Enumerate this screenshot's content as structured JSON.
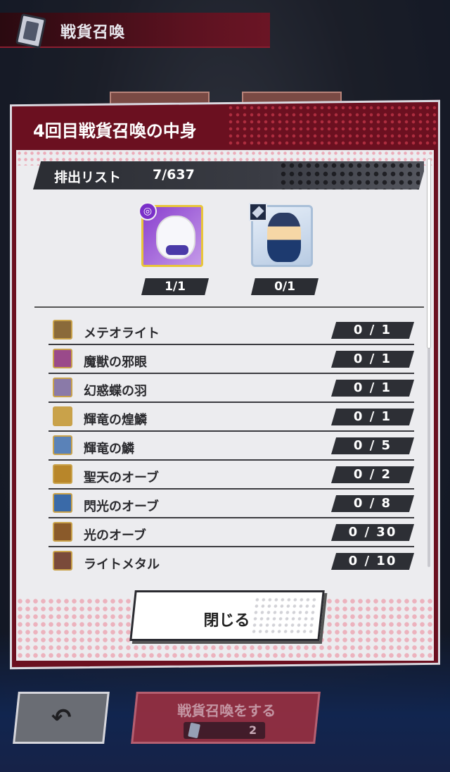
{
  "header": {
    "title": "戦貨召喚"
  },
  "dialog": {
    "title": "4回目戦貨召喚の中身",
    "list_label": "排出リスト",
    "list_count": "7/637",
    "featured": [
      {
        "count": "1/1",
        "badge": "purple-orb-badge"
      },
      {
        "count": "0/1",
        "badge": "card-badge"
      }
    ],
    "items": [
      {
        "name": "メテオライト",
        "count": "0 / 1",
        "icon": "meteorite-icon",
        "color": "#8a6a3a"
      },
      {
        "name": "魔獣の邪眼",
        "count": "0 / 1",
        "icon": "evil-eye-icon",
        "color": "#9a4a8a"
      },
      {
        "name": "幻惑蝶の羽",
        "count": "0 / 1",
        "icon": "butterfly-wing-icon",
        "color": "#8a7aa8"
      },
      {
        "name": "輝竜の煌鱗",
        "count": "0 / 1",
        "icon": "dragon-gem-scale-icon",
        "color": "#c9a24a"
      },
      {
        "name": "輝竜の鱗",
        "count": "0 / 5",
        "icon": "dragon-scale-icon",
        "color": "#5a82b8"
      },
      {
        "name": "聖天のオーブ",
        "count": "0 / 2",
        "icon": "holy-orb-icon",
        "color": "#b8862a"
      },
      {
        "name": "閃光のオーブ",
        "count": "0 / 8",
        "icon": "flash-orb-icon",
        "color": "#3a6aa8"
      },
      {
        "name": "光のオーブ",
        "count": "0 / 30",
        "icon": "light-orb-icon",
        "color": "#8a5a2a"
      },
      {
        "name": "ライトメタル",
        "count": "0 / 10",
        "icon": "light-metal-icon",
        "color": "#7a4a3a"
      }
    ],
    "close_label": "閉じる"
  },
  "footer": {
    "summon_label": "戦貨召喚をする",
    "summon_cost": "2"
  }
}
